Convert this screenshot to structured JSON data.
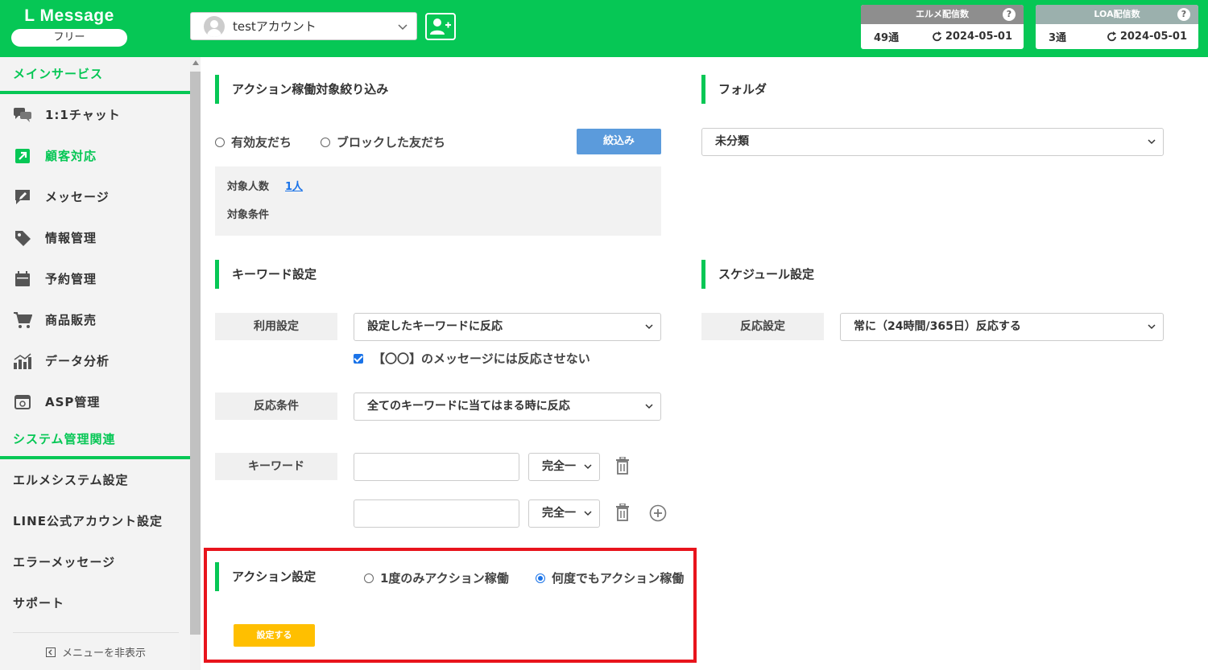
{
  "header": {
    "logo_title": "L Message",
    "plan_label": "フリー",
    "account_name": "testアカウント",
    "quota_elme": {
      "title": "エルメ配信数",
      "count": "49通",
      "date": "2024-05-01"
    },
    "quota_loa": {
      "title": "LOA配信数",
      "count": "3通",
      "date": "2024-05-01"
    }
  },
  "sidebar": {
    "main_section": "メインサービス",
    "items": [
      {
        "label": "1:1チャット",
        "icon": "chat-icon"
      },
      {
        "label": "顧客対応",
        "icon": "external-link-icon"
      },
      {
        "label": "メッセージ",
        "icon": "message-icon"
      },
      {
        "label": "情報管理",
        "icon": "tag-icon"
      },
      {
        "label": "予約管理",
        "icon": "calendar-icon"
      },
      {
        "label": "商品販売",
        "icon": "cart-icon"
      },
      {
        "label": "データ分析",
        "icon": "chart-icon"
      },
      {
        "label": "ASP管理",
        "icon": "window-icon"
      }
    ],
    "system_section": "システム管理関連",
    "system_items": [
      "エルメシステム設定",
      "LINE公式アカウント設定",
      "エラーメッセージ",
      "サポート"
    ],
    "hide_menu": "メニューを非表示"
  },
  "filter": {
    "title": "アクション稼働対象絞り込み",
    "radio_valid": "有効友だち",
    "radio_blocked": "ブロックした友だち",
    "button": "絞込み",
    "count_label": "対象人数",
    "count_value": "1人",
    "condition_label": "対象条件"
  },
  "folder": {
    "title": "フォルダ",
    "selected": "未分類"
  },
  "keyword": {
    "title": "キーワード設定",
    "usage_label": "利用設定",
    "usage_value": "設定したキーワードに反応",
    "checkbox_label": "【〇〇】のメッセージには反応させない",
    "condition_label": "反応条件",
    "condition_value": "全てのキーワードに当てはまる時に反応",
    "keyword_label": "キーワード",
    "match_1": "完全一",
    "match_2": "完全一"
  },
  "schedule": {
    "title": "スケジュール設定",
    "label": "反応設定",
    "value": "常に（24時間/365日）反応する"
  },
  "action": {
    "title": "アクション設定",
    "radio_once": "1度のみアクション稼働",
    "radio_any": "何度でもアクション稼働",
    "submit": "設定する"
  }
}
